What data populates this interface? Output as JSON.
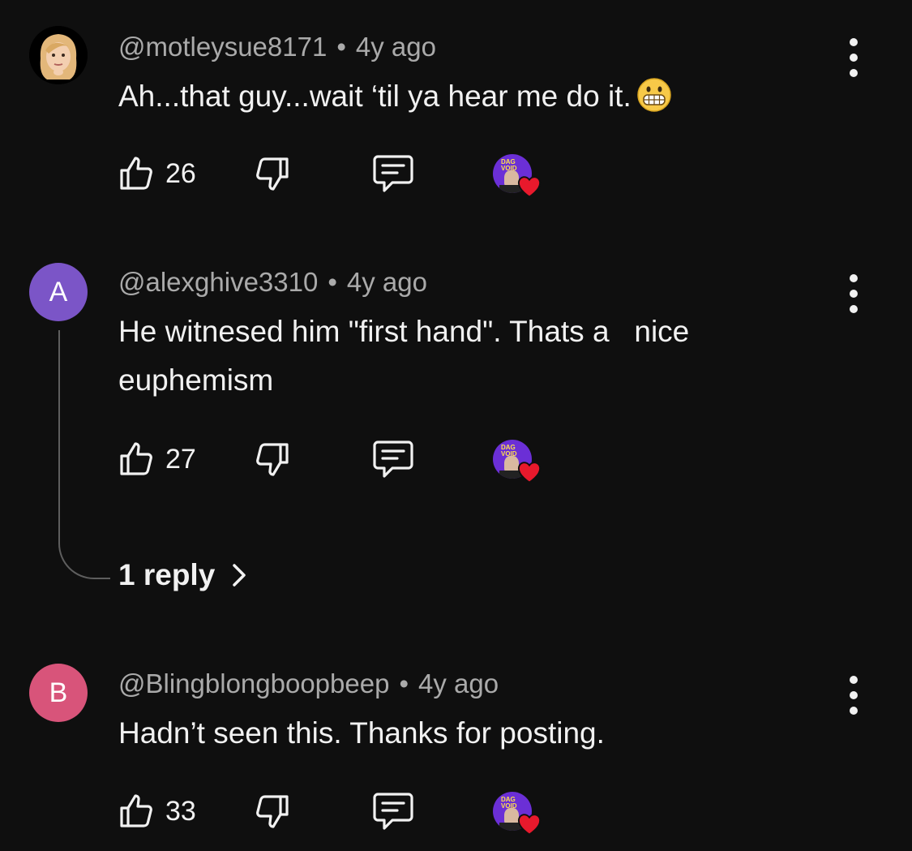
{
  "colors": {
    "background": "#0f0f0f",
    "meta_text": "#aaaaaa",
    "primary_text": "#f1f1f1",
    "avatar_a": "#7b55c7",
    "avatar_b": "#d8547a",
    "creator_heart": "#e8192c",
    "creator_avatar": "#6b2fd6"
  },
  "comments": [
    {
      "handle": "@motleysue8171",
      "separator": "•",
      "time": "4y ago",
      "text": "Ah...that guy...wait ‘til ya hear me do it.",
      "emoji_icon": "grimacing-face-icon",
      "likes": "26",
      "avatar_icon": "memoji-avatar-icon"
    },
    {
      "avatar_letter": "A",
      "handle": "@alexghive3310",
      "separator": "•",
      "time": "4y ago",
      "text": "He witnesed him \"first hand\". Thats a   nice euphemism",
      "likes": "27",
      "replies_label": "1 reply"
    },
    {
      "avatar_letter": "B",
      "handle": "@Blingblongboopbeep",
      "separator": "•",
      "time": "4y ago",
      "text": "Hadn’t seen this. Thanks for posting.",
      "likes": "33"
    }
  ],
  "creator_badge_text": "DAG VOID"
}
